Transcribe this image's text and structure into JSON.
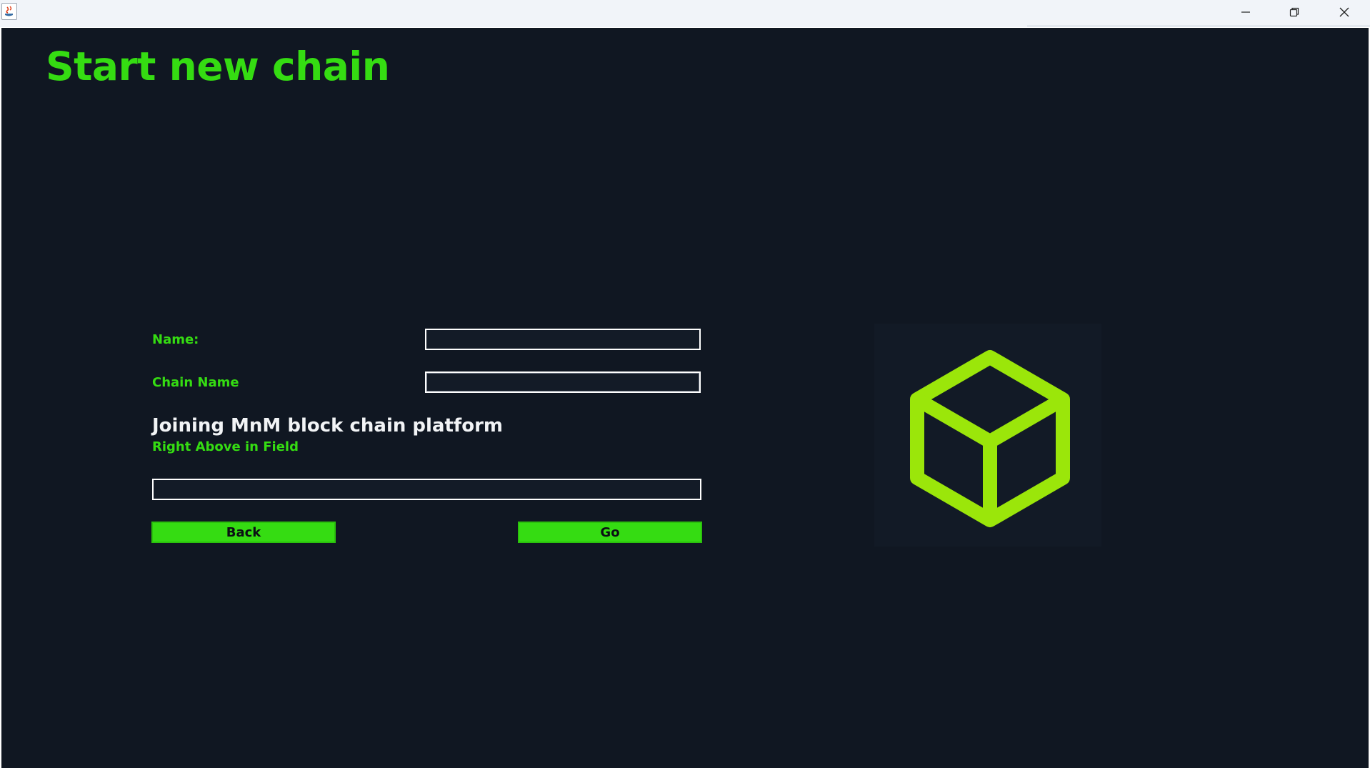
{
  "window": {
    "title": "",
    "controls": {
      "minimize_icon": "minimize-icon",
      "maximize_icon": "restore-icon",
      "close_icon": "close-icon"
    }
  },
  "page": {
    "title": "Start new chain"
  },
  "form": {
    "name_label": "Name:",
    "name_value": "",
    "chain_name_label": "Chain Name",
    "chain_name_value": "",
    "platform_heading": "Joining MnM block chain platform",
    "hint_label": "Right Above in Field",
    "extra_value": ""
  },
  "buttons": {
    "back_label": "Back",
    "go_label": "Go"
  },
  "logo": {
    "icon": "cube-icon"
  },
  "colors": {
    "background": "#101722",
    "accent_green": "#35dc12",
    "logo_green": "#9be60a",
    "heading_white": "#f2f4f6"
  }
}
